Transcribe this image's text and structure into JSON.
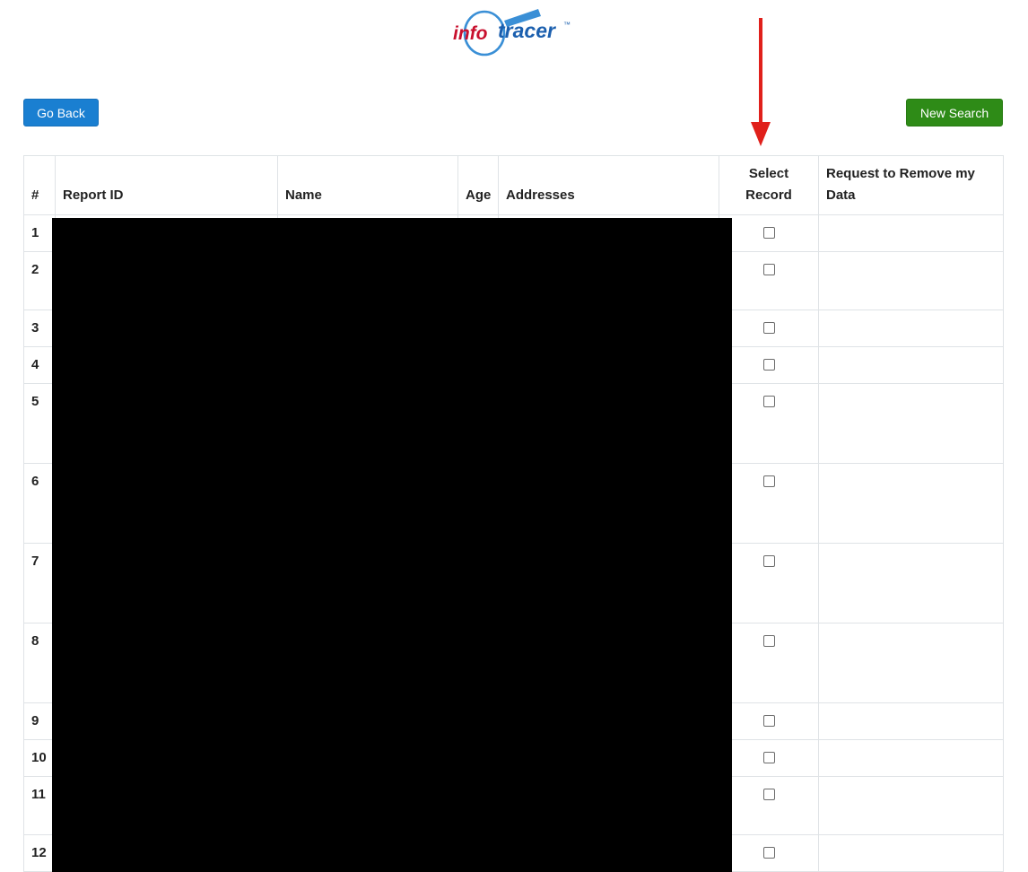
{
  "logo": {
    "part1": "info",
    "part2": "tracer",
    "tm": "™"
  },
  "buttons": {
    "go_back": "Go Back",
    "new_search": "New Search"
  },
  "table": {
    "headers": {
      "num": "#",
      "report_id": "Report ID",
      "name": "Name",
      "age": "Age",
      "addresses": "Addresses",
      "select_record": "Select Record",
      "remove": "Request to Remove my Data"
    },
    "rows": [
      {
        "num": "1"
      },
      {
        "num": "2"
      },
      {
        "num": "3"
      },
      {
        "num": "4"
      },
      {
        "num": "5"
      },
      {
        "num": "6"
      },
      {
        "num": "7"
      },
      {
        "num": "8"
      },
      {
        "num": "9"
      },
      {
        "num": "10"
      },
      {
        "num": "11"
      },
      {
        "num": "12"
      }
    ]
  },
  "colors": {
    "go_back_button": "#1a7fd1",
    "new_search_button": "#2e8b17",
    "arrow": "#e0201b",
    "logo_red": "#c8102e",
    "logo_blue": "#1b5fae"
  }
}
